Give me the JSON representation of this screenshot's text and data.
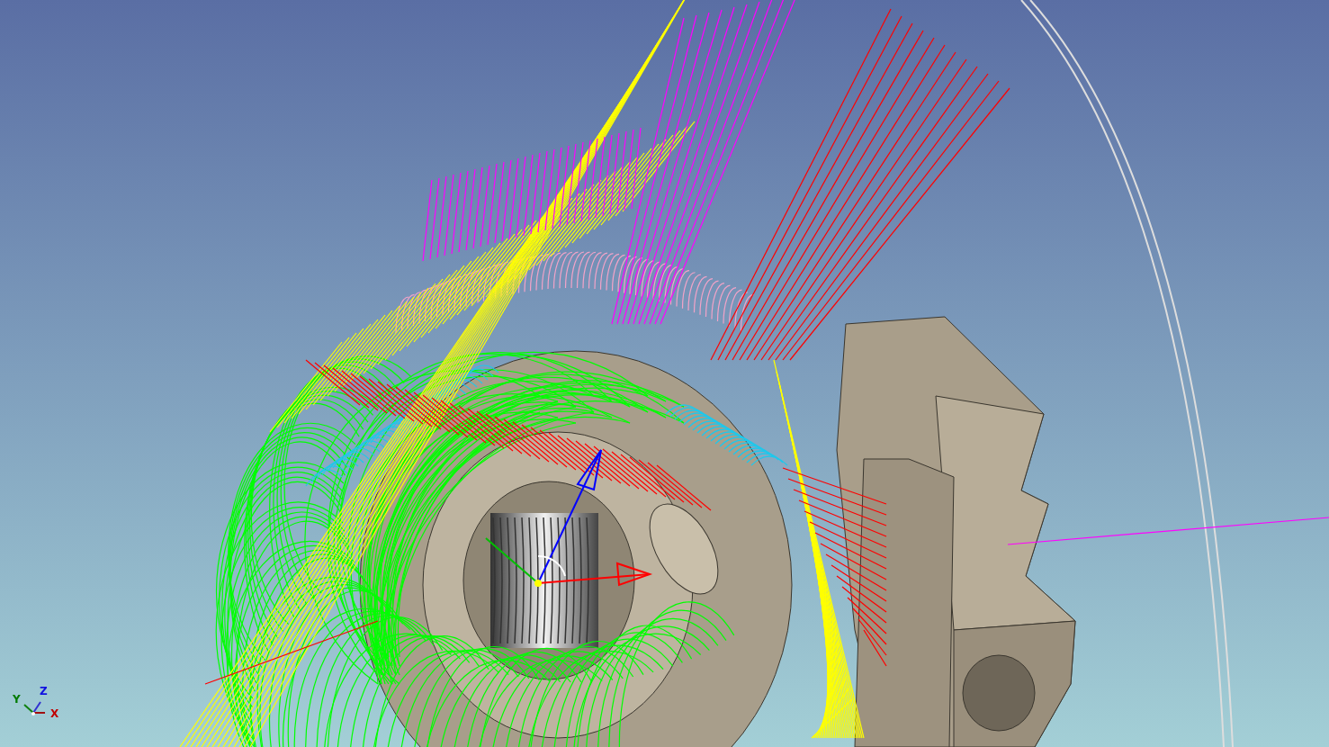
{
  "viewport": {
    "axis_labels": [
      {
        "text": "Z",
        "color": "#1010e0"
      },
      {
        "text": "Y",
        "color": "#007a00"
      },
      {
        "text": "X",
        "color": "#c00000"
      }
    ]
  }
}
